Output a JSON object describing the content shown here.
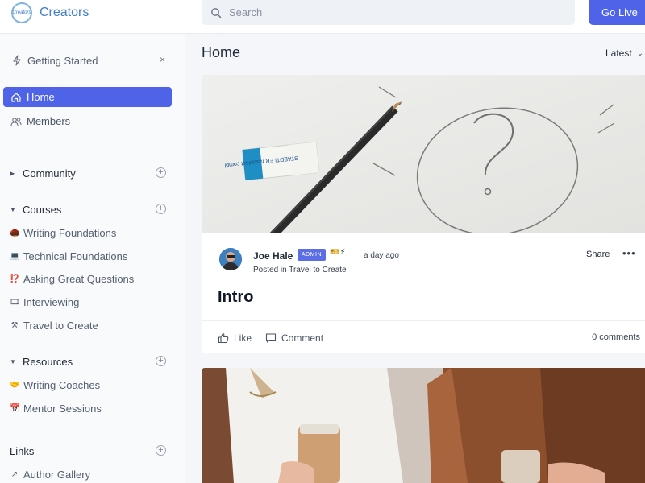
{
  "brand": {
    "name": "Creators",
    "logo_text": "Creators"
  },
  "search": {
    "placeholder": "Search"
  },
  "header": {
    "go_live_label": "Go Live"
  },
  "sidebar": {
    "getting_started": {
      "label": "Getting Started",
      "close_glyph": "×"
    },
    "nav": [
      {
        "label": "Home",
        "icon": "home-icon",
        "active": true
      },
      {
        "label": "Members",
        "icon": "members-icon",
        "active": false
      }
    ],
    "sections": [
      {
        "label": "Community",
        "expanded": false,
        "items": []
      },
      {
        "label": "Courses",
        "expanded": true,
        "items": [
          {
            "emoji": "🌰",
            "label": "Writing Foundations"
          },
          {
            "emoji": "💻",
            "label": "Technical Foundations"
          },
          {
            "emoji": "⁉️",
            "label": "Asking Great Questions"
          },
          {
            "emoji": "🎞",
            "label": "Interviewing"
          },
          {
            "emoji": "⚒",
            "label": "Travel to Create"
          }
        ]
      },
      {
        "label": "Resources",
        "expanded": true,
        "items": [
          {
            "emoji": "🤝",
            "label": "Writing Coaches"
          },
          {
            "emoji": "📅",
            "label": "Mentor Sessions"
          }
        ]
      }
    ],
    "links": {
      "label": "Links",
      "items": [
        {
          "glyph": "↗",
          "label": "Author Gallery"
        }
      ]
    }
  },
  "main": {
    "title": "Home",
    "sort": {
      "label": "Latest",
      "chevron": "⌄"
    }
  },
  "post": {
    "author": "Joe Hale",
    "badge": "ADMIN",
    "badge_icons": "🎫⚡",
    "time": "a day ago",
    "posted_in": "Posted in Travel to Create",
    "share_label": "Share",
    "more_glyph": "•••",
    "title": "Intro",
    "like_label": "Like",
    "comment_label": "Comment",
    "comments_count": "0 comments",
    "image_text": "STAEDTLER rasoplast combi"
  },
  "colors": {
    "accent": "#4f63e8",
    "brand": "#3f7ed0",
    "sidebar_bg": "#f8fafc",
    "page_bg": "#f4f6f9"
  }
}
